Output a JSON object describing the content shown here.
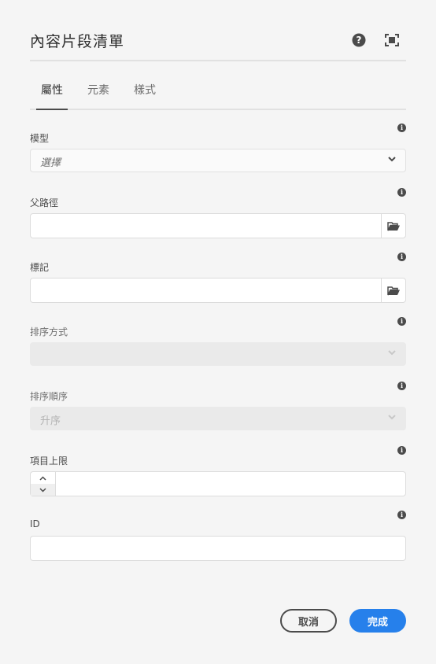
{
  "dialog": {
    "title": "內容片段清單",
    "help_icon": "help-icon",
    "fullscreen_icon": "fullscreen-icon"
  },
  "tabs": [
    {
      "label": "屬性",
      "active": true
    },
    {
      "label": "元素",
      "active": false
    },
    {
      "label": "樣式",
      "active": false
    }
  ],
  "fields": {
    "model": {
      "label": "模型",
      "value": "選擇"
    },
    "parent_path": {
      "label": "父路徑",
      "value": ""
    },
    "tags": {
      "label": "標記",
      "value": ""
    },
    "sort_by": {
      "label": "排序方式",
      "value": ""
    },
    "sort_order": {
      "label": "排序順序",
      "value": "升序"
    },
    "max_items": {
      "label": "項目上限",
      "value": ""
    },
    "id": {
      "label": "ID",
      "value": ""
    }
  },
  "footer": {
    "cancel_label": "取消",
    "done_label": "完成"
  },
  "colors": {
    "accent": "#2680eb",
    "background": "#f5f5f5"
  }
}
